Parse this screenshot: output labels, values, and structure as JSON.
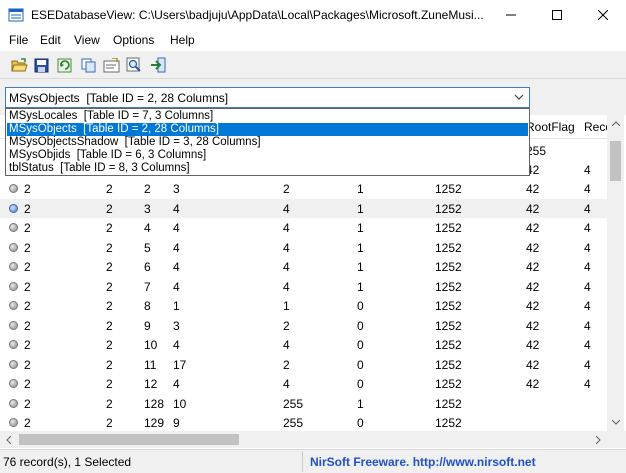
{
  "window": {
    "title": "ESEDatabaseView:  C:\\Users\\badjuju\\AppData\\Local\\Packages\\Microsoft.ZuneMusi..."
  },
  "menu": [
    "File",
    "Edit",
    "View",
    "Options",
    "Help"
  ],
  "toolbar": {
    "icons": [
      "open-folder-icon",
      "save-icon",
      "refresh-icon",
      "copy-icon",
      "properties-icon",
      "find-icon",
      "exit-icon"
    ]
  },
  "combo": {
    "selected": "MSysObjects  [Table ID = 2, 28 Columns]"
  },
  "dropdown": {
    "items": [
      "MSysLocales  [Table ID = 7, 3 Columns]",
      "MSysObjects  [Table ID = 2, 28 Columns]",
      "MSysObjectsShadow  [Table ID = 3, 28 Columns]",
      "MSysObjids  [Table ID = 6, 3 Columns]",
      "tblStatus  [Table ID = 8, 3 Columns]"
    ],
    "selected_index": 1
  },
  "table": {
    "headers": [
      "RootFlag",
      "Reco"
    ],
    "partial_row": [
      "255"
    ],
    "rows": [
      [
        "2",
        "2",
        "2",
        "3",
        "2",
        "1",
        "1252",
        "42",
        "4"
      ],
      [
        "2",
        "2",
        "3",
        "4",
        "4",
        "1",
        "1252",
        "42",
        "4"
      ],
      [
        "2",
        "2",
        "4",
        "4",
        "4",
        "1",
        "1252",
        "42",
        "4"
      ],
      [
        "2",
        "2",
        "5",
        "4",
        "4",
        "1",
        "1252",
        "42",
        "4"
      ],
      [
        "2",
        "2",
        "6",
        "4",
        "4",
        "1",
        "1252",
        "42",
        "4"
      ],
      [
        "2",
        "2",
        "7",
        "4",
        "4",
        "1",
        "1252",
        "42",
        "4"
      ],
      [
        "2",
        "2",
        "8",
        "1",
        "1",
        "0",
        "1252",
        "42",
        "4"
      ],
      [
        "2",
        "2",
        "9",
        "3",
        "2",
        "0",
        "1252",
        "42",
        "4"
      ],
      [
        "2",
        "2",
        "10",
        "4",
        "4",
        "0",
        "1252",
        "42",
        "4"
      ],
      [
        "2",
        "2",
        "11",
        "17",
        "2",
        "0",
        "1252",
        "42",
        "4"
      ],
      [
        "2",
        "2",
        "12",
        "4",
        "4",
        "0",
        "1252",
        "42",
        "4"
      ],
      [
        "2",
        "2",
        "128",
        "10",
        "255",
        "1",
        "1252",
        "",
        ""
      ],
      [
        "2",
        "2",
        "129",
        "9",
        "255",
        "0",
        "1252",
        "",
        ""
      ]
    ],
    "previous_row": [
      "42",
      "4"
    ],
    "selected_index": 1
  },
  "status": {
    "records": "76 record(s), 1 Selected",
    "credit": "NirSoft Freeware.  http://www.nirsoft.net"
  }
}
